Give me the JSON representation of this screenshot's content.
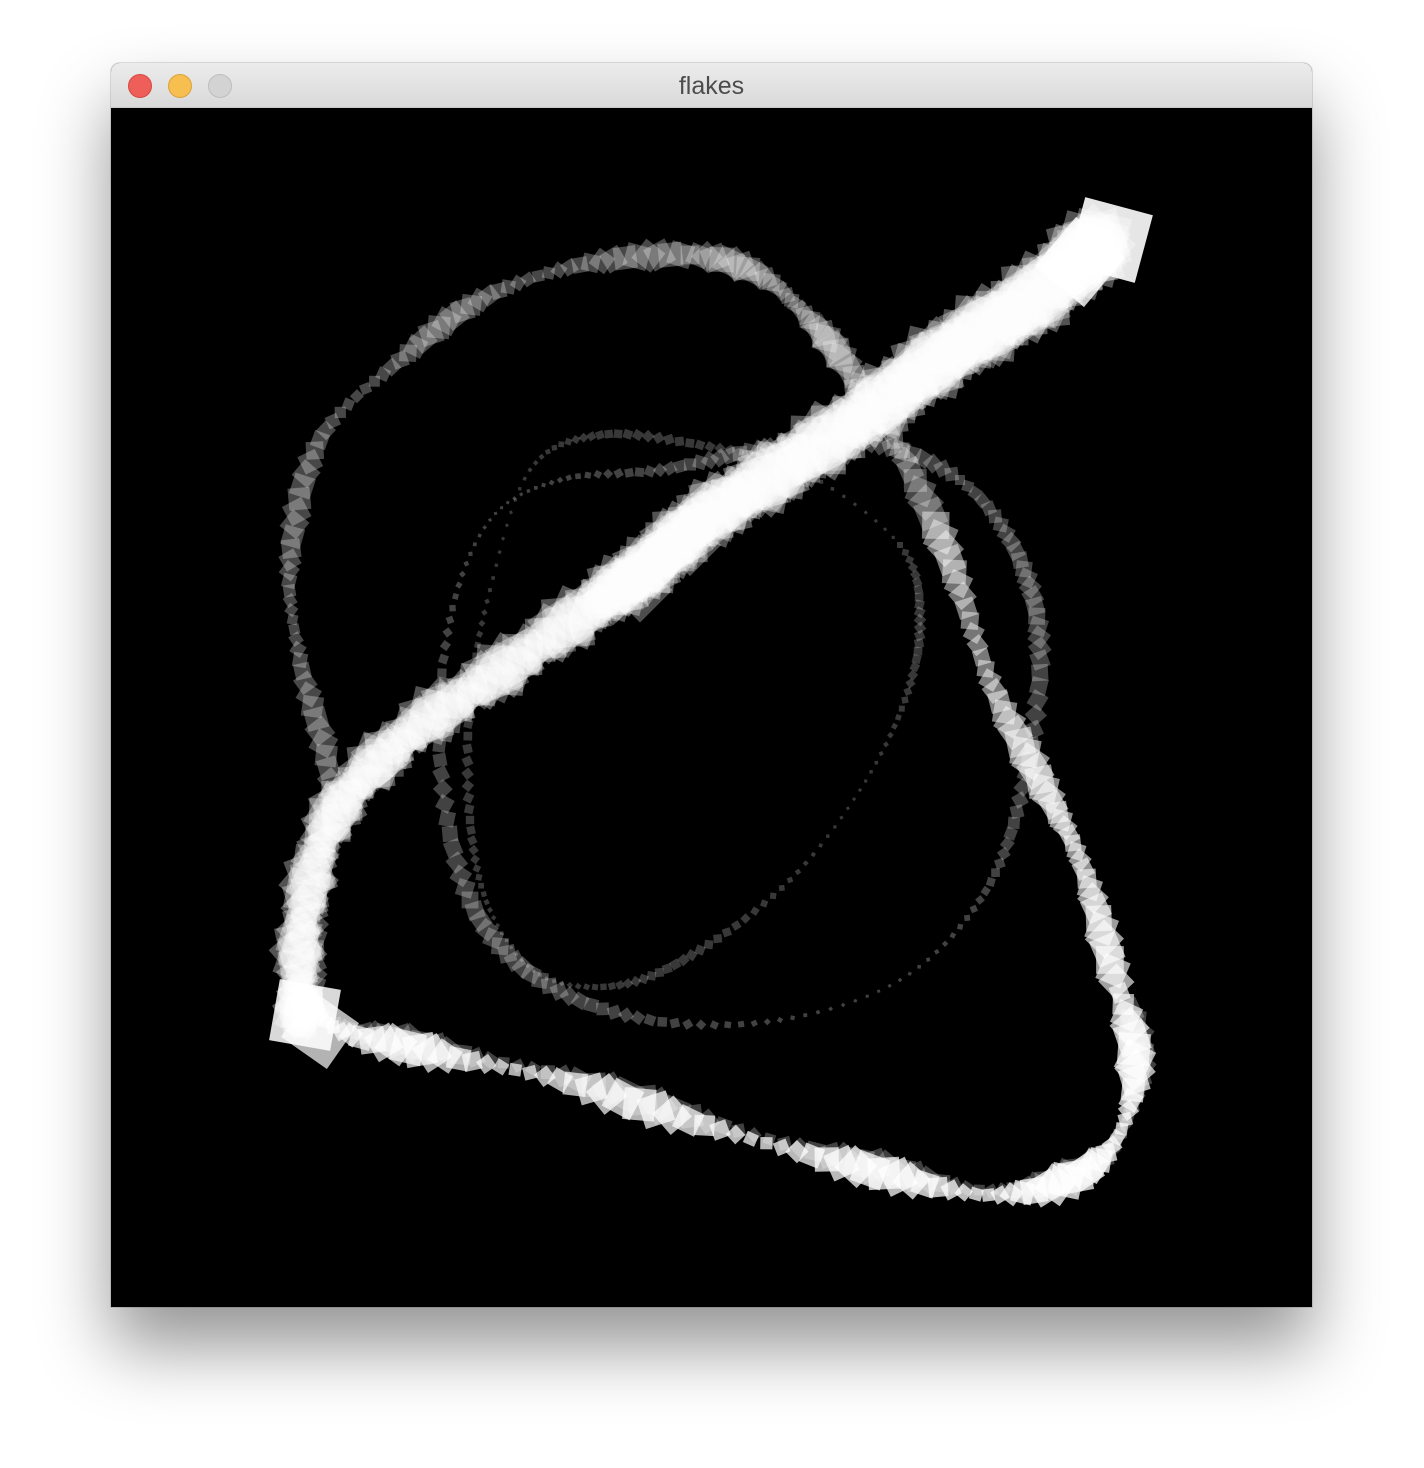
{
  "window": {
    "title": "flakes",
    "buttons": {
      "close": {
        "icon": "close-icon",
        "color": "#ed5f58"
      },
      "minimize": {
        "icon": "minimize-icon",
        "color": "#f6bf4f"
      },
      "zoom": {
        "icon": "zoom-icon",
        "color": "#d3d3d3"
      }
    }
  },
  "canvas": {
    "background": "#000000",
    "flake_color": "#ffffff",
    "trails": [
      {
        "id": "bright-stroke",
        "shape": "rotating-square",
        "brightness": "bright"
      },
      {
        "id": "outer-loop",
        "shape": "rotating-square",
        "brightness": "dim"
      },
      {
        "id": "middle-loop",
        "shape": "rotating-square",
        "brightness": "dim"
      },
      {
        "id": "inner-loop",
        "shape": "rotating-square",
        "brightness": "faint"
      }
    ]
  }
}
